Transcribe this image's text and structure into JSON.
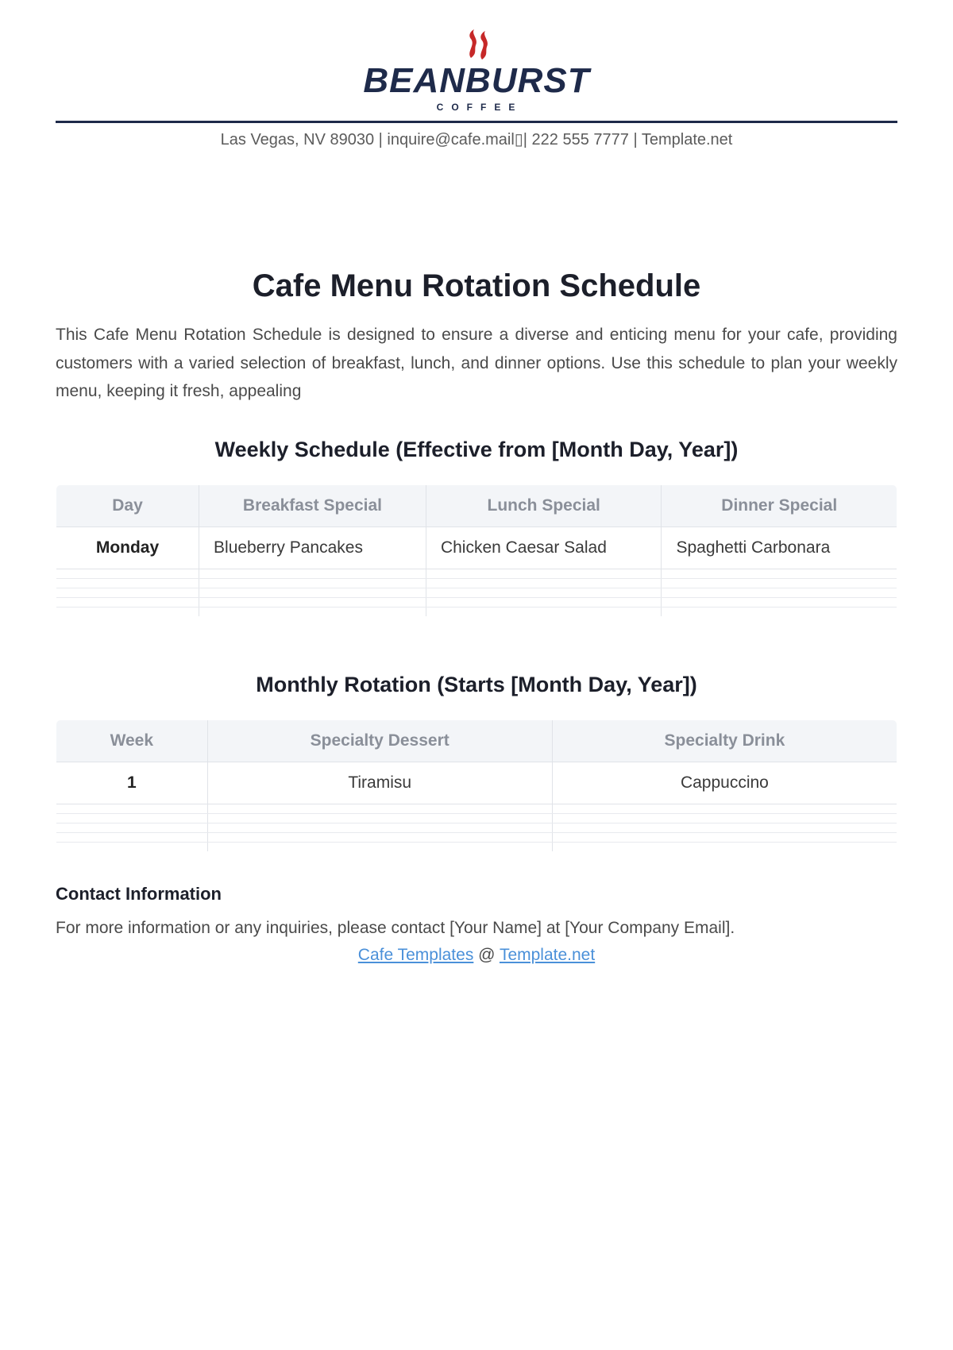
{
  "brand": {
    "name": "BEANBURST",
    "sub": "COFFEE",
    "accent": "#c62828",
    "navy": "#1e2a4a"
  },
  "header": {
    "contact_line": "Las Vegas, NV 89030 | inquire@cafe.mail▯| 222 555 7777 | Template.net"
  },
  "title": "Cafe Menu Rotation Schedule",
  "intro": "This Cafe Menu Rotation Schedule is designed to ensure a diverse and enticing menu for your cafe, providing customers with a varied selection of breakfast, lunch, and dinner options. Use this schedule to plan your weekly menu, keeping it fresh, appealing",
  "weekly": {
    "heading": "Weekly Schedule (Effective from [Month Day, Year])",
    "cols": [
      "Day",
      "Breakfast Special",
      "Lunch Special",
      "Dinner Special"
    ],
    "rows": [
      {
        "day": "Monday",
        "breakfast": "Blueberry Pancakes",
        "lunch": "Chicken Caesar Salad",
        "dinner": "Spaghetti Carbonara"
      }
    ]
  },
  "monthly": {
    "heading": "Monthly Rotation (Starts [Month Day, Year])",
    "cols": [
      "Week",
      "Specialty Dessert",
      "Specialty Drink"
    ],
    "rows": [
      {
        "week": "1",
        "dessert": "Tiramisu",
        "drink": "Cappuccino"
      }
    ]
  },
  "contact": {
    "heading": "Contact Information",
    "text": "For more information or any inquiries, please contact [Your Name] at [Your Company Email]."
  },
  "footer": {
    "link1": "Cafe Templates",
    "sep": " @ ",
    "link2": "Template.net"
  }
}
